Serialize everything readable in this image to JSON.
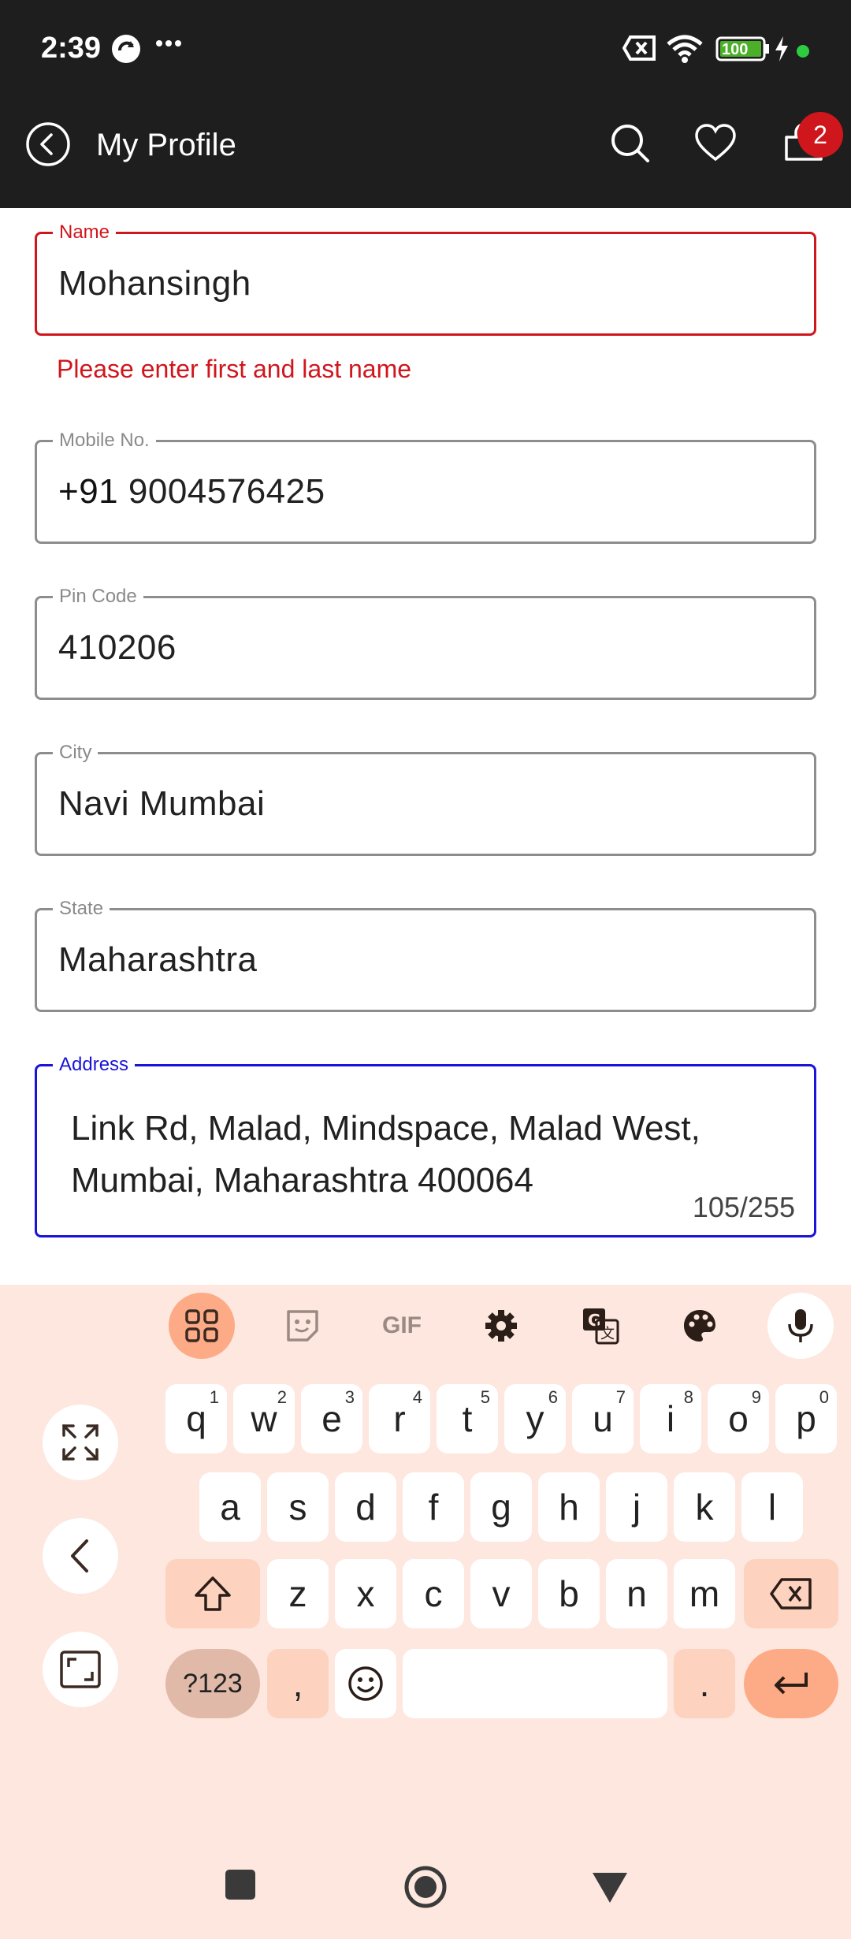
{
  "status_bar": {
    "time": "2:39",
    "battery": "100"
  },
  "app_bar": {
    "title": "My Profile",
    "cart_badge": "2"
  },
  "form": {
    "name": {
      "label": "Name",
      "value": "Mohansingh",
      "error": "Please enter first and last name"
    },
    "mobile": {
      "label": "Mobile No.",
      "prefix": "+91",
      "value": "9004576425"
    },
    "pin": {
      "label": "Pin Code",
      "value": "410206"
    },
    "city": {
      "label": "City",
      "value": "Navi Mumbai"
    },
    "state": {
      "label": "State",
      "value": "Maharashtra"
    },
    "address": {
      "label": "Address",
      "line1": "Link Rd, Malad, Mindspace, Malad West,",
      "line2": "Mumbai, Maharashtra 400064",
      "counter": "105/255"
    }
  },
  "keyboard": {
    "toolbar": [
      "apps-icon",
      "sticker-icon",
      "gif-icon",
      "settings-icon",
      "translate-icon",
      "palette-icon",
      "mic-icon"
    ],
    "gif_label": "GIF",
    "row1": [
      {
        "k": "q",
        "h": "1"
      },
      {
        "k": "w",
        "h": "2"
      },
      {
        "k": "e",
        "h": "3"
      },
      {
        "k": "r",
        "h": "4"
      },
      {
        "k": "t",
        "h": "5"
      },
      {
        "k": "y",
        "h": "6"
      },
      {
        "k": "u",
        "h": "7"
      },
      {
        "k": "i",
        "h": "8"
      },
      {
        "k": "o",
        "h": "9"
      },
      {
        "k": "p",
        "h": "0"
      }
    ],
    "row2": [
      "a",
      "s",
      "d",
      "f",
      "g",
      "h",
      "j",
      "k",
      "l"
    ],
    "row3": [
      "z",
      "x",
      "c",
      "v",
      "b",
      "n",
      "m"
    ],
    "sym_label": "?123",
    "comma": ",",
    "period": "."
  },
  "colors": {
    "accent_error": "#d0161d",
    "accent_focus": "#1a14d8",
    "keyboard_bg": "#fde7df",
    "appbar_bg": "#1e1e1e"
  }
}
